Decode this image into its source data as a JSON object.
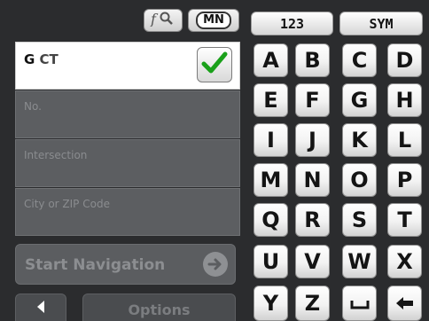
{
  "toolbar": {
    "search_icon": "search-icon",
    "map_region": "MN"
  },
  "address": {
    "street_value": "G",
    "street_value_suffix": "CT",
    "number_placeholder": "No.",
    "intersection_placeholder": "Intersection",
    "city_placeholder": "City or ZIP Code"
  },
  "actions": {
    "start_navigation": "Start Navigation",
    "options": "Options"
  },
  "keyboard": {
    "mode_numbers": "123",
    "mode_symbols": "SYM",
    "rows": [
      [
        "A",
        "B",
        "C",
        "D"
      ],
      [
        "E",
        "F",
        "G",
        "H"
      ],
      [
        "I",
        "J",
        "K",
        "L"
      ],
      [
        "M",
        "N",
        "O",
        "P"
      ],
      [
        "Q",
        "R",
        "S",
        "T"
      ],
      [
        "U",
        "V",
        "W",
        "X"
      ],
      [
        "Y",
        "Z"
      ]
    ]
  },
  "colors": {
    "background": "#2b2c2e",
    "check_green": "#1aa01a"
  }
}
